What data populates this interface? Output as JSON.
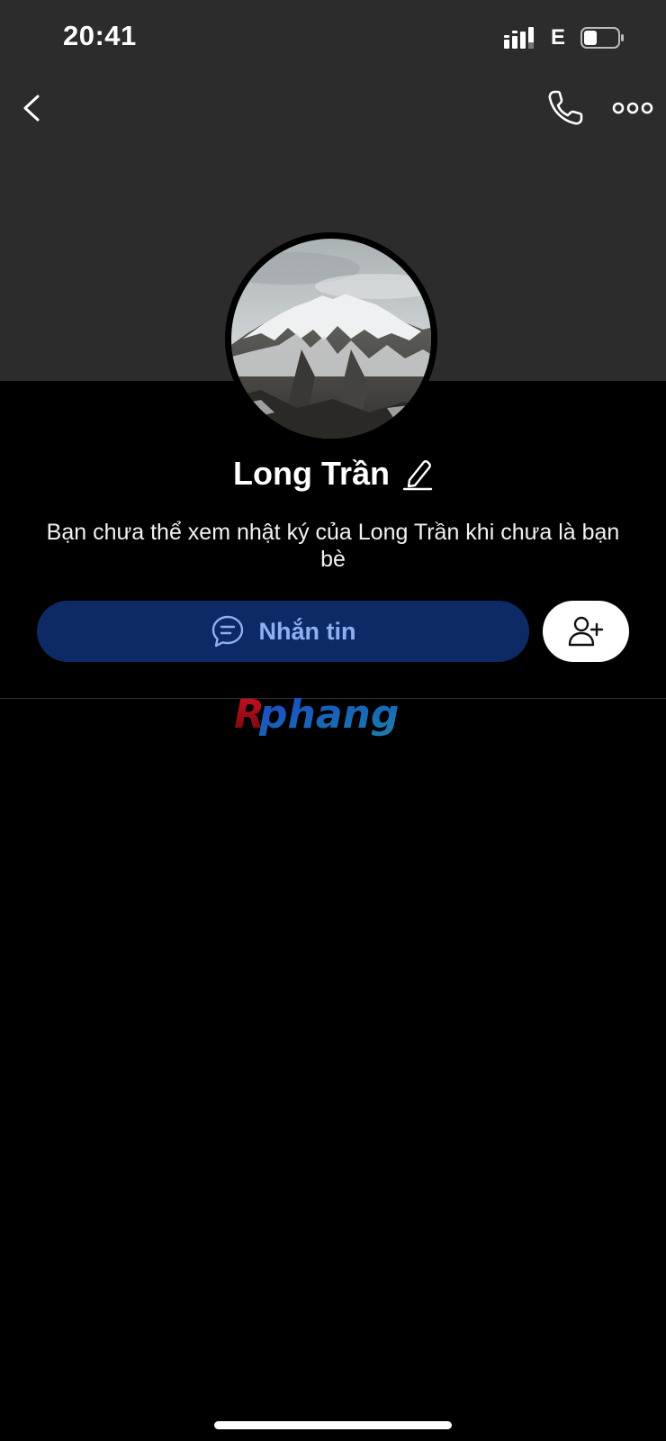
{
  "status_bar": {
    "time": "20:41",
    "network": "E",
    "signal_icon": "signal-bars-icon",
    "battery_icon": "battery-icon"
  },
  "nav": {
    "back_icon": "chevron-left-icon",
    "call_icon": "phone-icon",
    "more_icon": "more-dots-icon"
  },
  "profile": {
    "name": "Long Trần",
    "edit_icon": "pencil-icon",
    "notice": "Bạn chưa thể xem nhật ký của Long Trần khi chưa là bạn bè"
  },
  "actions": {
    "message_label": "Nhắn tin",
    "message_icon": "chat-bubble-icon",
    "add_friend_icon": "add-friend-icon"
  },
  "watermark": {
    "text": "Rphang"
  },
  "colors": {
    "cover": "#2c2c2c",
    "background": "#000000",
    "message_button": "#0e2a66",
    "message_text": "#8cb0f2"
  }
}
